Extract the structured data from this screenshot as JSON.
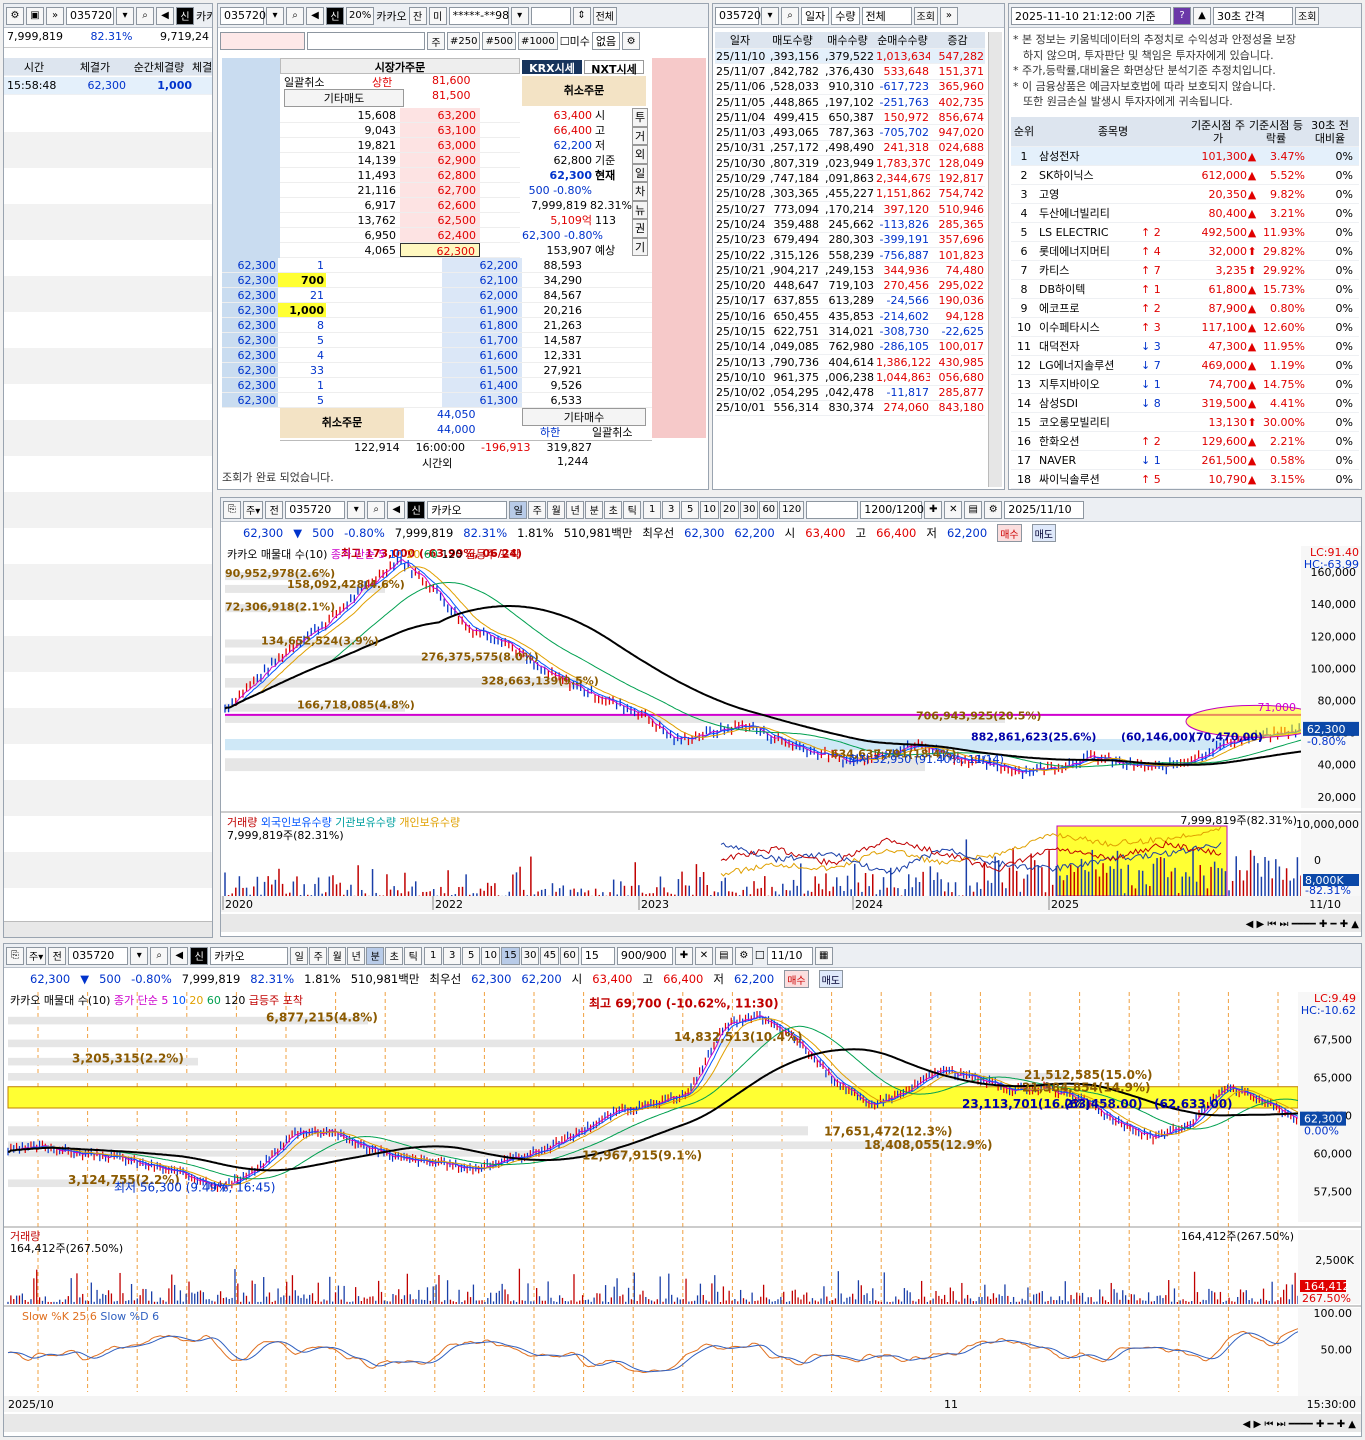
{
  "ticker": {
    "code": "035720",
    "name": "카카오",
    "credit": "신",
    "price": "62,300",
    "change": "500",
    "change_rate": "-0.80%",
    "volume": "7,999,819",
    "vol_ratio": "82.31%",
    "turnover": "1.81%",
    "amount": "510,981백만",
    "best_label": "최우선",
    "best_ask": "62,300",
    "best_bid": "62,200",
    "open_l": "시",
    "open": "63,400",
    "high_l": "고",
    "high": "66,400",
    "low_l": "저",
    "low": "62,200",
    "buy": "매수",
    "sell": "매도"
  },
  "tick_panel": {
    "vol": "7,999,819",
    "ratio": "82.31%",
    "prev": "9,719,24",
    "headers": [
      "시간",
      "체결가",
      "순간체결량",
      "체결"
    ],
    "rows": [
      {
        "time": "15:58:48",
        "price": "62,300",
        "qty": "1,000"
      }
    ]
  },
  "orderbook": {
    "toolbar": {
      "code": "035720",
      "credit": "신",
      "pct": "20%",
      "name": "카카오",
      "jan": "잔",
      "mi": "미",
      "acct": "*****-**98",
      "all": "전체",
      "ju": "주",
      "q1": "#250",
      "q2": "#500",
      "q3": "#1000",
      "misu": "미수",
      "none": "없음"
    },
    "market_order": "시장가주문",
    "cancel_all": "일괄취소",
    "upper_label": "상한",
    "upper": "81,600",
    "etc_sell": "기타매도",
    "etc_sell_price": "81,500",
    "krx": "KRX시세",
    "nxt": "NXT시세",
    "cancel_order": "취소주문",
    "asks": [
      {
        "q": "15,608",
        "p": "63,200"
      },
      {
        "q": "9,043",
        "p": "63,100"
      },
      {
        "q": "19,821",
        "p": "63,000"
      },
      {
        "q": "14,139",
        "p": "62,900"
      },
      {
        "q": "11,493",
        "p": "62,800"
      },
      {
        "q": "21,116",
        "p": "62,700"
      },
      {
        "q": "6,917",
        "p": "62,600"
      },
      {
        "q": "13,762",
        "p": "62,500"
      },
      {
        "q": "6,950",
        "p": "62,400"
      },
      {
        "q": "4,065",
        "p": "62,300"
      }
    ],
    "bids": [
      {
        "pp": "62,300",
        "pq": "1",
        "p": "62,200",
        "q": "88,593"
      },
      {
        "pp": "62,300",
        "pq": "700",
        "p": "62,100",
        "q": "34,290"
      },
      {
        "pp": "62,300",
        "pq": "21",
        "p": "62,000",
        "q": "84,567"
      },
      {
        "pp": "62,300",
        "pq": "1,000",
        "p": "61,900",
        "q": "20,216"
      },
      {
        "pp": "62,300",
        "pq": "8",
        "p": "61,800",
        "q": "21,263"
      },
      {
        "pp": "62,300",
        "pq": "5",
        "p": "61,700",
        "q": "14,587"
      },
      {
        "pp": "62,300",
        "pq": "4",
        "p": "61,600",
        "q": "12,331"
      },
      {
        "pp": "62,300",
        "pq": "33",
        "p": "61,500",
        "q": "27,921"
      },
      {
        "pp": "62,300",
        "pq": "1",
        "p": "61,400",
        "q": "9,526"
      },
      {
        "pp": "62,300",
        "pq": "5",
        "p": "61,300",
        "q": "6,533"
      }
    ],
    "info": [
      {
        "v": "63,400",
        "l": "시"
      },
      {
        "v": "66,400",
        "l": "고"
      },
      {
        "v": "62,200",
        "l": "저"
      },
      {
        "v": "62,800",
        "l": "기준"
      },
      {
        "v": "62,300",
        "l": "현재"
      },
      {
        "v": "500 -0.80%",
        "l": ""
      },
      {
        "v": "7,999,819",
        "l": "82.31%"
      },
      {
        "v": "5,109억",
        "l": "113"
      },
      {
        "v": "62,300 -0.80%",
        "l": ""
      },
      {
        "v": "153,907",
        "l": "예상"
      }
    ],
    "side_tabs": [
      "투",
      "거",
      "외",
      "일",
      "차",
      "뉴",
      "권",
      "기"
    ],
    "etc_buy": "기타매수",
    "lower_label": "하한",
    "lower": "44,050",
    "lower2": "44,000",
    "cancel_all2": "일괄취소",
    "tot_ask": "122,914",
    "time": "16:00:00",
    "diff": "-196,913",
    "tot_bid": "319,827",
    "after": "시간외",
    "after_q": "1,244",
    "status": "조회가 완료 되었습니다."
  },
  "daily": {
    "code": "035720",
    "sel1": "일자",
    "sel2": "수량",
    "sel3": "전체",
    "btn": "조회",
    "headers": [
      "일자",
      "매도수량",
      "매수수량",
      "순매수수량",
      "증감"
    ],
    "rows": [
      [
        "25/11/10",
        ",393,156",
        ",379,522",
        "1,013,634",
        "547,282"
      ],
      [
        "25/11/07",
        ",842,782",
        ",376,430",
        "533,648",
        "151,371"
      ],
      [
        "25/11/06",
        ",528,033",
        "910,310",
        "-617,723",
        "365,960"
      ],
      [
        "25/11/05",
        ",448,865",
        ",197,102",
        "-251,763",
        "402,735"
      ],
      [
        "25/11/04",
        "499,415",
        "650,387",
        "150,972",
        "856,674"
      ],
      [
        "25/11/03",
        ",493,065",
        "787,363",
        "-705,702",
        "947,020"
      ],
      [
        "25/10/31",
        ",257,172",
        ",498,490",
        "241,318",
        "024,688"
      ],
      [
        "25/10/30",
        ",807,319",
        ",023,949",
        "1,783,370",
        "128,049"
      ],
      [
        "25/10/29",
        ",747,184",
        ",091,863",
        "2,344,679",
        "192,817"
      ],
      [
        "25/10/28",
        ",303,365",
        ",455,227",
        "1,151,862",
        "754,742"
      ],
      [
        "25/10/27",
        "773,094",
        ",170,214",
        "397,120",
        "510,946"
      ],
      [
        "25/10/24",
        "359,488",
        "245,662",
        "-113,826",
        "285,365"
      ],
      [
        "25/10/23",
        "679,494",
        "280,303",
        "-399,191",
        "357,696"
      ],
      [
        "25/10/22",
        ",315,126",
        "558,239",
        "-756,887",
        "101,823"
      ],
      [
        "25/10/21",
        ",904,217",
        ",249,153",
        "344,936",
        "74,480"
      ],
      [
        "25/10/20",
        "448,647",
        "719,103",
        "270,456",
        "295,022"
      ],
      [
        "25/10/17",
        "637,855",
        "613,289",
        "-24,566",
        "190,036"
      ],
      [
        "25/10/16",
        "650,455",
        "435,853",
        "-214,602",
        "94,128"
      ],
      [
        "25/10/15",
        "622,751",
        "314,021",
        "-308,730",
        "-22,625"
      ],
      [
        "25/10/14",
        ",049,085",
        "762,980",
        "-286,105",
        "100,017"
      ],
      [
        "25/10/13",
        ",790,736",
        "404,614",
        "1,386,122",
        "430,985"
      ],
      [
        "25/10/10",
        "961,375",
        ",006,238",
        "1,044,863",
        "056,680"
      ],
      [
        "25/10/02",
        ",054,295",
        ",042,478",
        "-11,817",
        "285,877"
      ],
      [
        "25/10/01",
        "556,314",
        "830,374",
        "274,060",
        "843,180"
      ]
    ]
  },
  "ranking": {
    "datetime": "2025-11-10 21:12:00 기준",
    "interval": "30초 간격",
    "btn": "조회",
    "notice": [
      "* 본 정보는 키움빅데이터의 추정치로 수익성과 안정성을 보장",
      "하지 않으며, 투자판단 및 책임은 투자자에게 있습니다.",
      "* 주가,등락률,대비율은 화면상단 분석기준 추정치입니다.",
      "* 이 금융상품은 예금자보호법에 따라 보호되지 않습니다.",
      "또한 원금손실 발생시 투자자에게 귀속됩니다."
    ],
    "headers": [
      "순위",
      "종목명",
      "기준시점 주가",
      "기준시점 등락률",
      "30초 전 대비율"
    ],
    "rows": [
      [
        "1",
        "삼성전자",
        "",
        "101,300",
        "3.47%",
        "0%"
      ],
      [
        "2",
        "SK하이닉스",
        "",
        "612,000",
        "5.52%",
        "0%"
      ],
      [
        "3",
        "고영",
        "",
        "20,350",
        "9.82%",
        "0%"
      ],
      [
        "4",
        "두산에너빌리티",
        "",
        "80,400",
        "3.21%",
        "0%"
      ],
      [
        "5",
        "LS ELECTRIC",
        "↑ 2",
        "492,500",
        "11.93%",
        "0%"
      ],
      [
        "6",
        "롯데에너지머티",
        "↑ 4",
        "32,000",
        "29.82%",
        "0%"
      ],
      [
        "7",
        "카티스",
        "↑ 7",
        "3,235",
        "29.92%",
        "0%"
      ],
      [
        "8",
        "DB하이텍",
        "↑ 1",
        "61,800",
        "15.73%",
        "0%"
      ],
      [
        "9",
        "에코프로",
        "↑ 2",
        "87,900",
        "0.80%",
        "0%"
      ],
      [
        "10",
        "이수페타시스",
        "↑ 3",
        "117,100",
        "12.60%",
        "0%"
      ],
      [
        "11",
        "대덕전자",
        "↓ 3",
        "47,300",
        "11.95%",
        "0%"
      ],
      [
        "12",
        "LG에너지솔루션",
        "↓ 7",
        "469,000",
        "1.19%",
        "0%"
      ],
      [
        "13",
        "지투지바이오",
        "↓ 1",
        "74,700",
        "14.75%",
        "0%"
      ],
      [
        "14",
        "삼성SDI",
        "↓ 8",
        "319,500",
        "4.41%",
        "0%"
      ],
      [
        "15",
        "코오롱모빌리티",
        "",
        "13,130",
        "30.00%",
        "0%"
      ],
      [
        "16",
        "한화오션",
        "↑ 2",
        "129,600",
        "2.21%",
        "0%"
      ],
      [
        "17",
        "NAVER",
        "↓ 1",
        "261,500",
        "0.58%",
        "0%"
      ],
      [
        "18",
        "싸이닉솔루션",
        "↑ 5",
        "10,790",
        "3.15%",
        "0%"
      ]
    ]
  },
  "chart1": {
    "periods": [
      "일",
      "주",
      "월",
      "년",
      "분",
      "초",
      "틱"
    ],
    "nums": [
      "1",
      "3",
      "5",
      "10",
      "20",
      "30",
      "60",
      "120"
    ],
    "count": "1200/1200",
    "date": "2025/11/10",
    "legend": {
      "title": "카카오 매물대 수(10)",
      "ma": "종가 단순 5",
      "m10": "10",
      "m20": "20",
      "m60": "60",
      "m120": "120",
      "surge": "급등주 포착"
    },
    "lc": "LC:91.40",
    "hc": "HC:-63.99",
    "y_ticks": [
      "160,000",
      "140,000",
      "120,000",
      "100,000",
      "80,000",
      "60,000",
      "40,000",
      "20,000"
    ],
    "annots": [
      {
        "t": "최고 173,000 (-63.99%, 06/24)"
      },
      {
        "t": "90,952,978(2.6%)"
      },
      {
        "t": "158,092,428(4.6%)"
      },
      {
        "t": "72,306,918(2.1%)"
      },
      {
        "t": "134,652,524(3.9%)"
      },
      {
        "t": "276,375,575(8.0%)"
      },
      {
        "t": "328,663,139(9.5%)"
      },
      {
        "t": "166,718,085(4.8%)"
      },
      {
        "t": "706,943,925(20.5%)"
      },
      {
        "t": "882,861,623(25.6%)"
      },
      {
        "t": "(60,146,00)"
      },
      {
        "t": "(70,470,00)"
      },
      {
        "t": "634,637,791(18.4%)"
      },
      {
        "t": "최저 32,950 (91.40%, 11/14)"
      }
    ],
    "hline": "71,000",
    "cur": "62,300",
    "cur_pct": "-0.80%",
    "vol_legend": {
      "a": "거래량",
      "b": "외국인보유수량",
      "c": "기관보유수량",
      "d": "개인보유수량"
    },
    "vol_note": "7,999,819주(82.31%)",
    "vol_note2": "7,999,819주(82.31%)",
    "vol_ticks": [
      "10,000,000",
      "0"
    ],
    "vol_cur": "8,000K",
    "vol_cur2": "-82.31%",
    "x_ticks": [
      "2020",
      "2022",
      "2023",
      "2024",
      "2025"
    ],
    "x_end": "11/10"
  },
  "chart2": {
    "nums": [
      "1",
      "3",
      "5",
      "10",
      "15",
      "30",
      "45",
      "60"
    ],
    "interval": "15",
    "count": "900/900",
    "date": "11/10",
    "lc": "LC:9.49",
    "hc": "HC:-10.62",
    "y_ticks": [
      "67,500",
      "65,000",
      "62,500",
      "60,000",
      "57,500"
    ],
    "annots": [
      {
        "t": "6,877,215(4.8%)"
      },
      {
        "t": "최고 69,700 (-10.62%, 11:30)"
      },
      {
        "t": "14,832,513(10.4%)"
      },
      {
        "t": "3,205,315(2.2%)"
      },
      {
        "t": "21,512,585(15.0%)"
      },
      {
        "t": "21,384,854(14.9%)"
      },
      {
        "t": "23,113,701(16.2%)"
      },
      {
        "t": "(63,458.00)"
      },
      {
        "t": "(62,633.00)"
      },
      {
        "t": "17,651,472(12.3%)"
      },
      {
        "t": "18,408,055(12.9%)"
      },
      {
        "t": "12,967,915(9.1%)"
      },
      {
        "t": "3,124,755(2.2%)"
      },
      {
        "t": "최저 56,300 (9.49%, 16:45)"
      }
    ],
    "cur": "62,300",
    "cur_pct": "0.00%",
    "vol_legend": "거래량",
    "vol_note": "164,412주(267.50%)",
    "vol_note2": "164,412주(267.50%)",
    "vol_tick": "2,500K",
    "vol_cur": "164,412",
    "vol_cur2": "267.50%",
    "stoch_legend": {
      "k": "Slow %K 25,6",
      "d": "Slow %D 6"
    },
    "stoch_ticks": [
      "100.00",
      "50.00"
    ],
    "x_left": "2025/10",
    "x_mid": "11",
    "x_end": "15:30:00"
  }
}
